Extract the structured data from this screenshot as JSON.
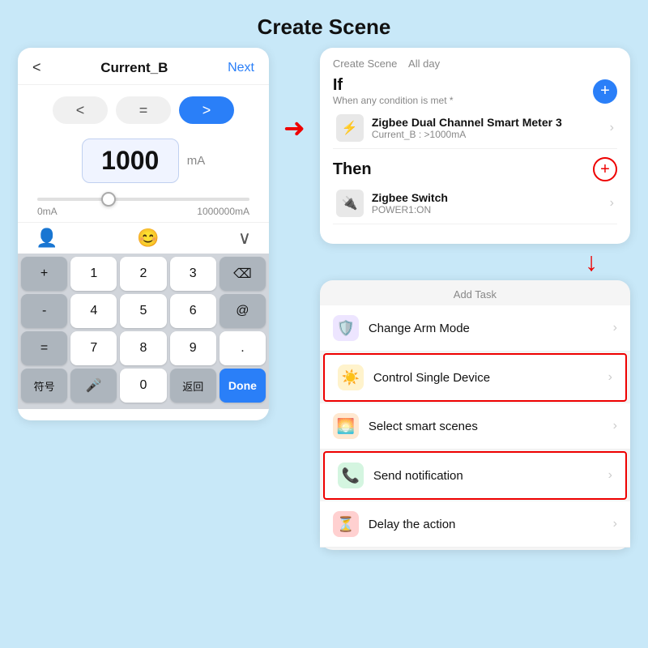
{
  "pageTitle": "Create Scene",
  "leftPanel": {
    "backLabel": "<",
    "title": "Current_B",
    "nextLabel": "Next",
    "comparators": [
      {
        "label": "<",
        "active": false
      },
      {
        "label": "=",
        "active": false
      },
      {
        "label": ">",
        "active": true
      }
    ],
    "value": "1000",
    "unit": "mA",
    "sliderMin": "0mA",
    "sliderMax": "1000000mA",
    "toolbar": {
      "leftIcon": "👤",
      "centerIcon": "😊",
      "rightIcon": "∨"
    },
    "keyboard": {
      "rows": [
        [
          {
            "label": "+",
            "type": "gray"
          },
          {
            "label": "1",
            "type": "white"
          },
          {
            "label": "2",
            "type": "white"
          },
          {
            "label": "3",
            "type": "white"
          },
          {
            "label": "⌫",
            "type": "gray"
          }
        ],
        [
          {
            "label": "-",
            "type": "gray"
          },
          {
            "label": "4",
            "type": "white"
          },
          {
            "label": "5",
            "type": "white"
          },
          {
            "label": "6",
            "type": "white"
          },
          {
            "label": "@",
            "type": "gray"
          }
        ],
        [
          {
            "label": "=",
            "type": "gray"
          },
          {
            "label": "7",
            "type": "white"
          },
          {
            "label": "8",
            "type": "white"
          },
          {
            "label": "9",
            "type": "white"
          },
          {
            "label": ".",
            "type": "white"
          }
        ],
        [
          {
            "label": "符号",
            "type": "gray"
          },
          {
            "label": "🎤",
            "type": "gray"
          },
          {
            "label": "0",
            "type": "white"
          },
          {
            "label": "返回",
            "type": "gray"
          },
          {
            "label": "Done",
            "type": "blue"
          }
        ]
      ]
    }
  },
  "rightTopPanel": {
    "panelTitle": "Create Scene",
    "allDay": "All day",
    "ifSection": {
      "title": "If",
      "subtitle": "When any condition is met *",
      "addIcon": "+"
    },
    "ifDevice": {
      "name": "Zigbee Dual Channel Smart Meter 3",
      "sub": "Current_B : >1000mA"
    },
    "thenSection": {
      "title": "Then",
      "addIcon": "+"
    },
    "thenDevice": {
      "name": "Zigbee Switch",
      "sub": "POWER1:ON"
    }
  },
  "addTaskPanel": {
    "title": "Add Task",
    "items": [
      {
        "label": "Change Arm Mode",
        "icon": "🛡️",
        "iconBg": "purple",
        "highlighted": false
      },
      {
        "label": "Control Single Device",
        "icon": "☀️",
        "iconBg": "yellow",
        "highlighted": true
      },
      {
        "label": "Select smart scenes",
        "icon": "🌅",
        "iconBg": "orange",
        "highlighted": false
      },
      {
        "label": "Send notification",
        "icon": "📞",
        "iconBg": "green",
        "highlighted": true
      },
      {
        "label": "Delay the action",
        "icon": "⏳",
        "iconBg": "red2",
        "highlighted": false
      }
    ]
  }
}
